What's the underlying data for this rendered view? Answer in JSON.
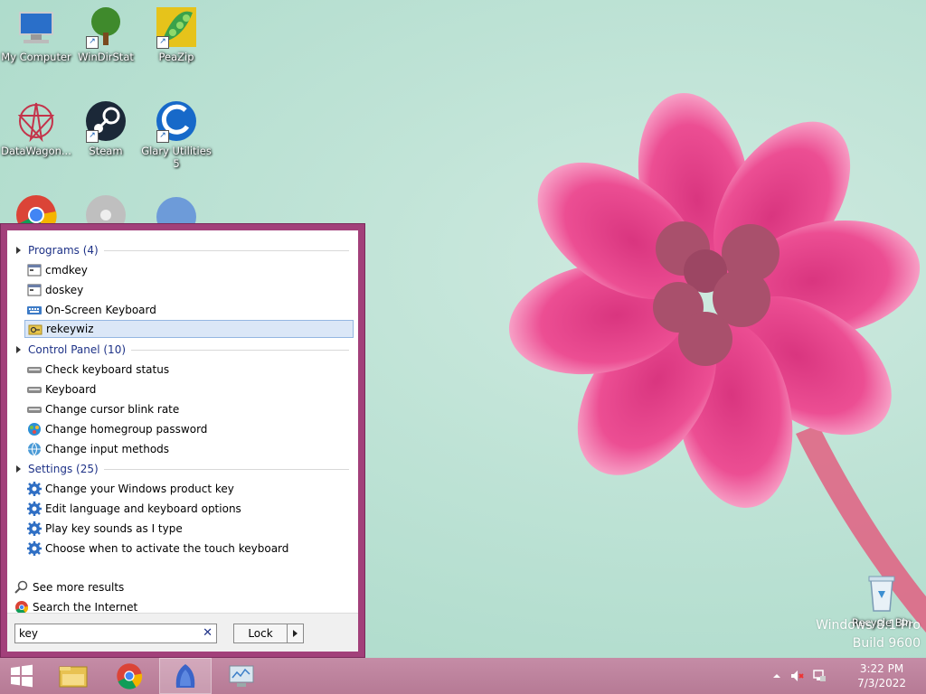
{
  "desktop": {
    "icons": [
      {
        "label": "My Computer"
      },
      {
        "label": "WinDirStat"
      },
      {
        "label": "PeaZip"
      },
      {
        "label": "DataWagon..."
      },
      {
        "label": "Steam"
      },
      {
        "label": "Glary Utilities 5"
      }
    ],
    "watermark_line1": "Windows 8.1 Pro",
    "watermark_line2": "Build 9600",
    "recycle_bin": "Recycle Bin"
  },
  "start_menu": {
    "categories": {
      "programs": "Programs (4)",
      "control_panel": "Control Panel (10)",
      "settings": "Settings (25)"
    },
    "programs": [
      "cmdkey",
      "doskey",
      "On-Screen Keyboard",
      "rekeywiz"
    ],
    "control_panel": [
      "Check keyboard status",
      "Keyboard",
      "Change cursor blink rate",
      "Change homegroup password",
      "Change input methods"
    ],
    "settings": [
      "Change your Windows product key",
      "Edit language and keyboard options",
      "Play key sounds as I type",
      "Choose when to activate the touch keyboard"
    ],
    "see_more": "See more results",
    "search_internet": "Search the Internet",
    "search_value": "key",
    "clear_symbol": "✕",
    "lock_label": "Lock"
  },
  "taskbar": {
    "time": "3:22 PM",
    "date": "7/3/2022"
  },
  "colors": {
    "start_menu_border": "#a2407a",
    "taskbar": "#c0849e",
    "category_text": "#1e3287"
  }
}
